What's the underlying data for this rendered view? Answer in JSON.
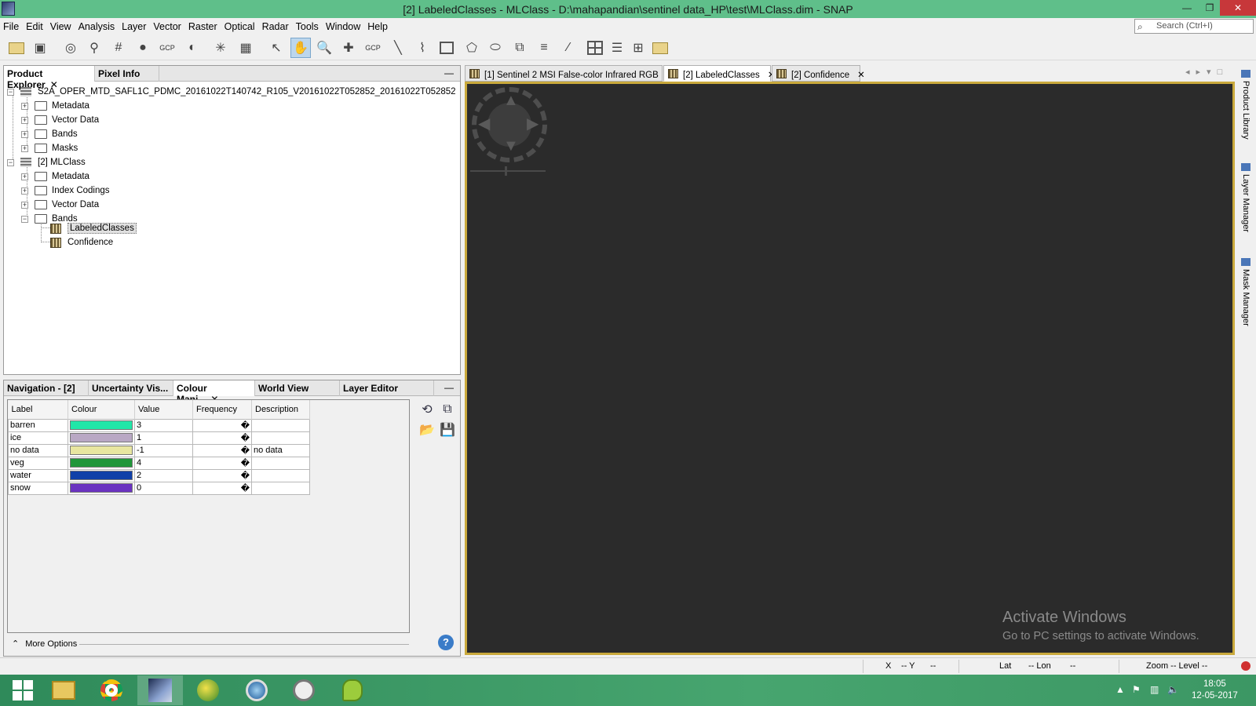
{
  "window": {
    "title": "[2] LabeledClasses - MLClass - D:\\mahapandian\\sentinel data_HP\\test\\MLClass.dim - SNAP",
    "minimize": "—",
    "maximize": "❐",
    "close": "✕"
  },
  "menu": [
    "File",
    "Edit",
    "View",
    "Analysis",
    "Layer",
    "Vector",
    "Raster",
    "Optical",
    "Radar",
    "Tools",
    "Window",
    "Help"
  ],
  "search": {
    "placeholder": "Search (Ctrl+I)"
  },
  "toolbar": {
    "gcp_label": "GCP"
  },
  "explorer": {
    "tabs": [
      "Product Explorer",
      "Pixel Info"
    ],
    "close_glyph": "✕",
    "minimize_glyph": "—",
    "tree": {
      "product1": "S2A_OPER_MTD_SAFL1C_PDMC_20161022T140742_R105_V20161022T052852_20161022T052852",
      "product1_children": [
        "Metadata",
        "Vector Data",
        "Bands",
        "Masks"
      ],
      "product2": "[2] MLClass",
      "product2_children": [
        "Metadata",
        "Index Codings",
        "Vector Data",
        "Bands"
      ],
      "bands": [
        "LabeledClasses",
        "Confidence"
      ]
    }
  },
  "colour_panel": {
    "tabs": [
      "Navigation - [2] ...",
      "Uncertainty Vis...",
      "Colour Mani...",
      "World View",
      "Layer Editor"
    ],
    "close_glyph": "✕",
    "minimize_glyph": "—",
    "columns": [
      "Label",
      "Colour",
      "Value",
      "Frequency",
      "Description"
    ],
    "rows": [
      {
        "label": "barren",
        "color": "#22e6a8",
        "value": "3",
        "frequency": "�",
        "description": ""
      },
      {
        "label": "ice",
        "color": "#b9a8c4",
        "value": "1",
        "frequency": "�",
        "description": ""
      },
      {
        "label": "no data",
        "color": "#e8e6a0",
        "value": "-1",
        "frequency": "�",
        "description": "no data"
      },
      {
        "label": "veg",
        "color": "#20963a",
        "value": "4",
        "frequency": "�",
        "description": ""
      },
      {
        "label": "water",
        "color": "#1040a8",
        "value": "2",
        "frequency": "�",
        "description": ""
      },
      {
        "label": "snow",
        "color": "#6a32c0",
        "value": "0",
        "frequency": "�",
        "description": ""
      }
    ],
    "more_options": "More Options",
    "help": "?"
  },
  "view_tabs": [
    {
      "label": "[1] Sentinel 2 MSI False-color Infrared RGB"
    },
    {
      "label": "[2] LabeledClasses"
    },
    {
      "label": "[2] Confidence"
    }
  ],
  "view_close_glyph": "✕",
  "side_panels": [
    "Product Library",
    "Layer Manager",
    "Mask Manager"
  ],
  "watermark": {
    "line1": "Activate Windows",
    "line2": "Go to PC settings to activate Windows."
  },
  "status": {
    "x": "X",
    "x_val": "-- Y",
    "y_val": "--",
    "lat": "Lat",
    "lat_val": "-- Lon",
    "lon_val": "--",
    "zoom": "Zoom -- Level --"
  },
  "clock": {
    "time": "18:05",
    "date": "12-05-2017"
  }
}
